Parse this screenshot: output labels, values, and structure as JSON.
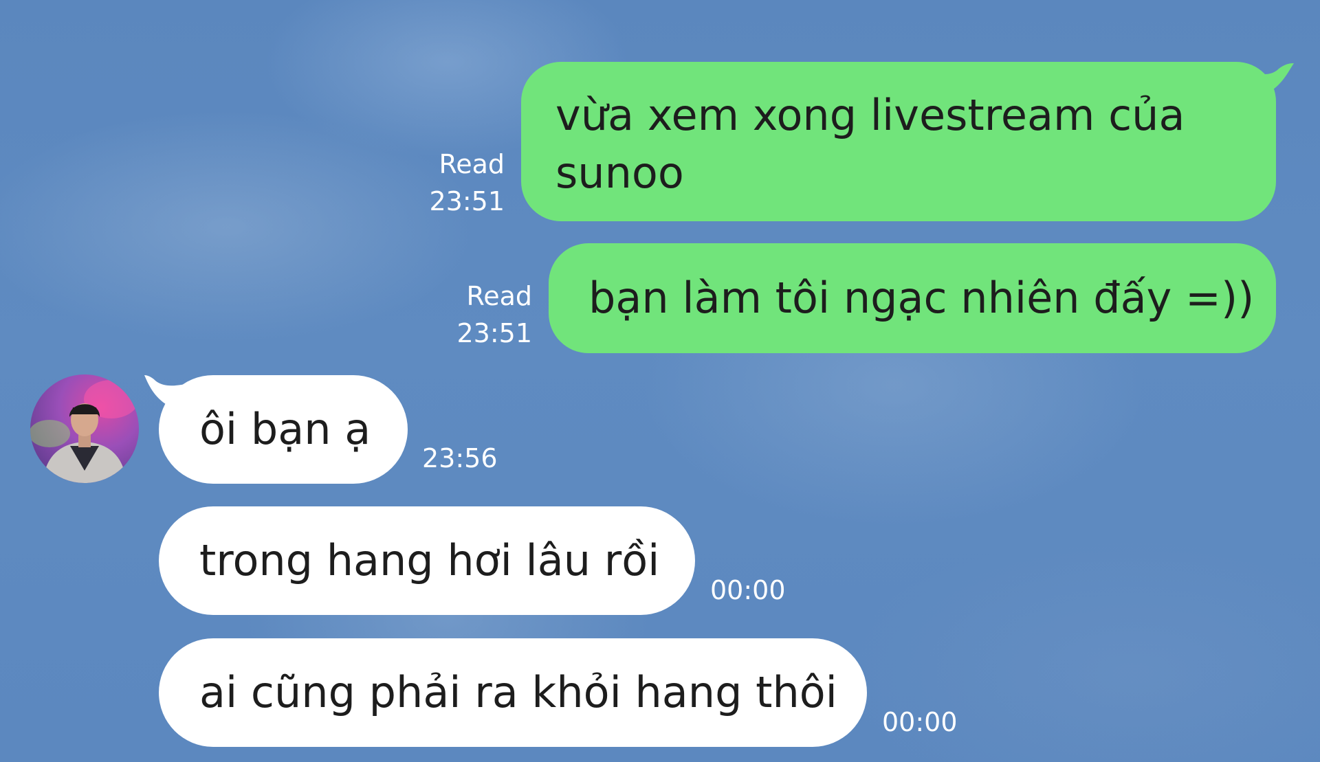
{
  "conversation": {
    "messages": [
      {
        "direction": "outgoing",
        "lines": [
          "vừa xem xong livestream của",
          "sunoo"
        ],
        "read_label": "Read",
        "time": "23:51"
      },
      {
        "direction": "outgoing",
        "lines": [
          "bạn làm tôi ngạc nhiên đấy =))"
        ],
        "read_label": "Read",
        "time": "23:51"
      },
      {
        "direction": "incoming",
        "lines": [
          "ôi bạn ạ"
        ],
        "time": "23:56"
      },
      {
        "direction": "incoming",
        "lines": [
          "trong hang hơi lâu rồi"
        ],
        "time": "00:00"
      },
      {
        "direction": "incoming",
        "lines": [
          "ai cũng phải ra khỏi hang thôi"
        ],
        "time": "00:00"
      }
    ]
  },
  "colors": {
    "background": "#5a86bd",
    "outgoing_bubble": "#71e47b",
    "incoming_bubble": "#ffffff",
    "message_text": "#1d1d1d",
    "meta_text": "#ffffff"
  },
  "icons": {
    "avatar": "contact-avatar"
  }
}
